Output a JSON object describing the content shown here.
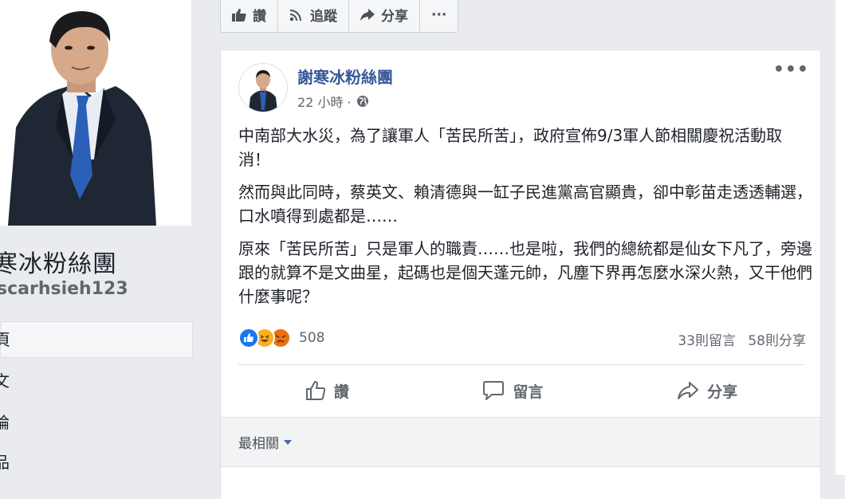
{
  "left": {
    "page_name": "寒冰粉絲團",
    "page_handle": "scarhsieh123",
    "nav": [
      {
        "label": "頁"
      },
      {
        "label": "文"
      },
      {
        "label": "論"
      },
      {
        "label": "品"
      }
    ]
  },
  "top_actions": {
    "like": "讚",
    "follow": "追蹤",
    "share": "分享",
    "more": "···"
  },
  "post": {
    "author": "謝寒冰粉絲團",
    "time": "22 小時 ·",
    "paragraphs": [
      "中南部大水災，為了讓軍人「苦民所苦」，政府宣佈9/3軍人節相關慶祝活動取消！",
      "然而與此同時，蔡英文、賴清德與一缸子民進黨高官顯貴，卻中彰苗走透透輔選，口水噴得到處都是……",
      "原來「苦民所苦」只是軍人的職責……也是啦，我們的總統都是仙女下凡了，旁邊跟的就算不是文曲星，起碼也是個天蓬元帥，凡塵下界再怎麼水深火熱，又干他們什麼事呢？"
    ],
    "reaction_count": "508",
    "comment_count": "33則留言",
    "share_count": "58則分享",
    "actions": {
      "like": "讚",
      "comment": "留言",
      "share": "分享"
    },
    "sort_label": "最相關",
    "more": "•••"
  },
  "colors": {
    "link": "#365899",
    "like_blue": "#1877f2",
    "haha_yellow": "#f7b125",
    "angry_orange": "#e9710f"
  }
}
